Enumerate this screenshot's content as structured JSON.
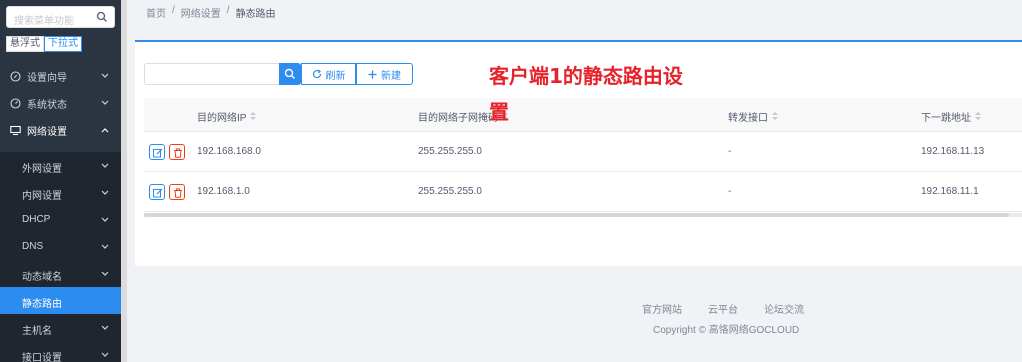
{
  "sidebar": {
    "search_placeholder": "搜索菜单功能",
    "modes": [
      "悬浮式",
      "下拉式"
    ],
    "menu": [
      {
        "label": "设置向导"
      },
      {
        "label": "系统状态"
      },
      {
        "label": "网络设置"
      }
    ],
    "submenu": [
      {
        "label": "外网设置"
      },
      {
        "label": "内网设置"
      },
      {
        "label": "DHCP"
      },
      {
        "label": "DNS"
      },
      {
        "label": "动态域名"
      },
      {
        "label": "静态路由"
      },
      {
        "label": "主机名"
      },
      {
        "label": "接口设置"
      }
    ]
  },
  "breadcrumb": [
    "首页",
    "/",
    "网络设置",
    "/",
    "静态路由"
  ],
  "toolbar": {
    "search_value": "",
    "refresh_label": "刷新",
    "new_label": "新建"
  },
  "annotation": "客户端1的静态路由设置",
  "table": {
    "headers": [
      "目的网络IP",
      "目的网络子网掩码",
      "转发接口",
      "下一跳地址"
    ],
    "rows": [
      {
        "ip": "192.168.168.0",
        "mask": "255.255.255.0",
        "iface": "-",
        "nexthop": "192.168.11.13"
      },
      {
        "ip": "192.168.1.0",
        "mask": "255.255.255.0",
        "iface": "-",
        "nexthop": "192.168.11.1"
      }
    ]
  },
  "footer": {
    "links": [
      "官方网站",
      "云平台",
      "论坛交流"
    ],
    "copyright": "Copyright © 高恪网络GOCLOUD"
  },
  "colors": {
    "accent": "#2d8cf0",
    "sidebar_bg": "#2b3441",
    "danger": "#ed4014",
    "annotation": "#e8222a"
  }
}
